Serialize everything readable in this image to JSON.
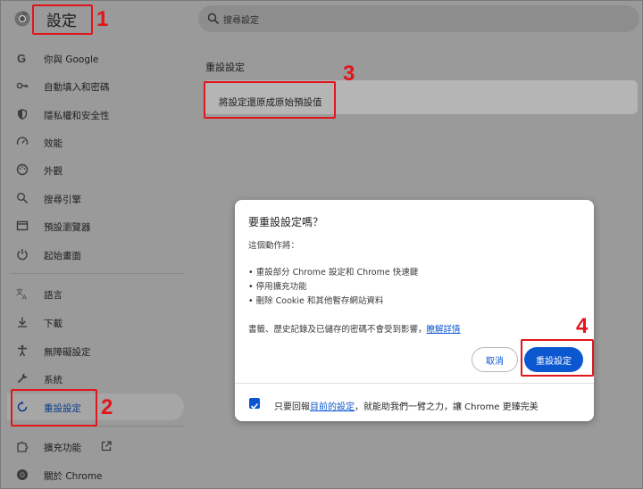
{
  "header": {
    "title": "設定",
    "search_placeholder": "搜尋設定"
  },
  "sidebar": {
    "items": [
      {
        "label": "你與 Google",
        "icon": "google-g-icon"
      },
      {
        "label": "自動填入和密碼",
        "icon": "key-icon"
      },
      {
        "label": "隱私權和安全性",
        "icon": "shield-icon"
      },
      {
        "label": "效能",
        "icon": "speedometer-icon"
      },
      {
        "label": "外觀",
        "icon": "palette-icon"
      },
      {
        "label": "搜尋引擎",
        "icon": "search-icon"
      },
      {
        "label": "預設瀏覽器",
        "icon": "browser-window-icon"
      },
      {
        "label": "起始畫面",
        "icon": "power-icon"
      },
      {
        "label": "語言",
        "icon": "translate-icon"
      },
      {
        "label": "下載",
        "icon": "download-icon"
      },
      {
        "label": "無障礙設定",
        "icon": "accessibility-icon"
      },
      {
        "label": "系統",
        "icon": "wrench-icon"
      },
      {
        "label": "重設設定",
        "icon": "reset-icon",
        "active": true
      },
      {
        "label": "擴充功能",
        "icon": "puzzle-icon"
      },
      {
        "label": "關於 Chrome",
        "icon": "chrome-icon"
      }
    ]
  },
  "main": {
    "section_title": "重設設定",
    "card_label": "將設定還原成原始預設值"
  },
  "dialog": {
    "title": "要重設設定嗎？",
    "intro": "這個動作將：",
    "bullets": [
      "• 重設部分 Chrome 設定和 Chrome 快速鍵",
      "• 停用擴充功能",
      "• 刪除 Cookie 和其他暫存網站資料"
    ],
    "note": "書籤、歷史記錄及已儲存的密碼不會受到影響，",
    "learn_more": "瞭解詳情",
    "cancel_label": "取消",
    "reset_label": "重設設定",
    "footer_prefix": "只要回報",
    "footer_link": "目前的設定",
    "footer_suffix": "，就能助我們一臂之力，讓 Chrome 更臻完美",
    "checkbox_checked": true
  },
  "annotations": {
    "n1": "1",
    "n2": "2",
    "n3": "3",
    "n4": "4",
    "color": "#e0161b"
  },
  "colors": {
    "accent": "#0b57d0",
    "overlay_bg": "#9a9a9a"
  }
}
